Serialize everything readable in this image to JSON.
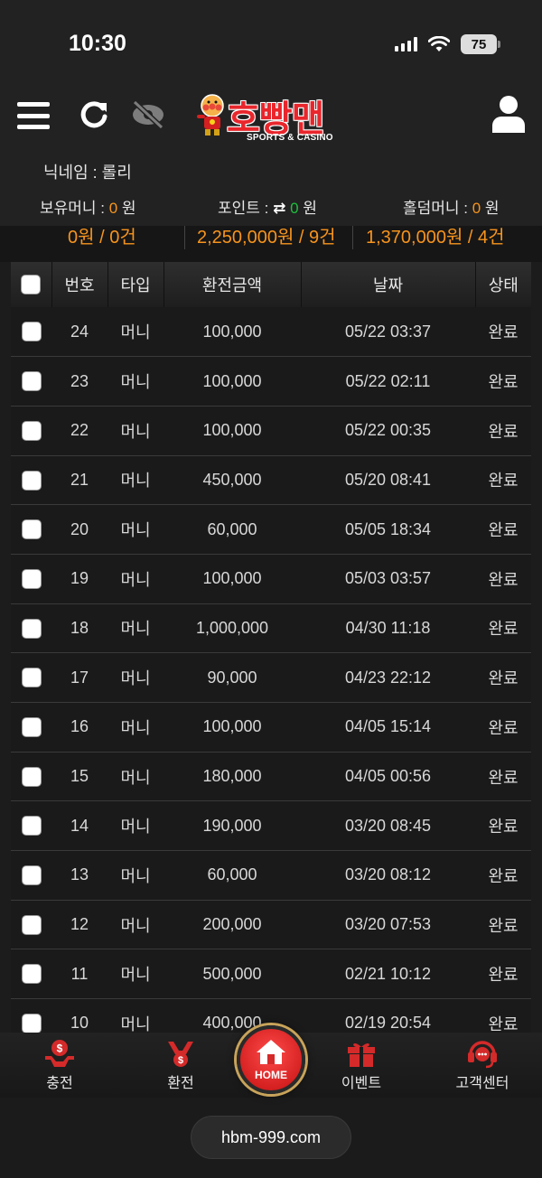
{
  "status": {
    "time": "10:30",
    "battery": "75"
  },
  "brand": {
    "name": "호빵맨",
    "sub": "SPORTS & CASINO"
  },
  "user": {
    "nickname": "닉네임 : 롤리",
    "money_label": "보유머니 : ",
    "money_value": "0",
    "money_unit": " 원",
    "point_label": "포인트 : ",
    "point_value": "0",
    "point_unit": " 원",
    "holdem_label": "홀덤머니 : ",
    "holdem_value": "0",
    "holdem_unit": " 원"
  },
  "summary": [
    "0원 / 0건",
    "2,250,000원 / 9건",
    "1,370,000원 / 4건"
  ],
  "table": {
    "headers": [
      "번호",
      "타입",
      "환전금액",
      "날짜",
      "상태"
    ],
    "rows": [
      {
        "no": "24",
        "type": "머니",
        "amount": "100,000",
        "date": "05/22 03:37",
        "status": "완료"
      },
      {
        "no": "23",
        "type": "머니",
        "amount": "100,000",
        "date": "05/22 02:11",
        "status": "완료"
      },
      {
        "no": "22",
        "type": "머니",
        "amount": "100,000",
        "date": "05/22 00:35",
        "status": "완료"
      },
      {
        "no": "21",
        "type": "머니",
        "amount": "450,000",
        "date": "05/20 08:41",
        "status": "완료"
      },
      {
        "no": "20",
        "type": "머니",
        "amount": "60,000",
        "date": "05/05 18:34",
        "status": "완료"
      },
      {
        "no": "19",
        "type": "머니",
        "amount": "100,000",
        "date": "05/03 03:57",
        "status": "완료"
      },
      {
        "no": "18",
        "type": "머니",
        "amount": "1,000,000",
        "date": "04/30 11:18",
        "status": "완료"
      },
      {
        "no": "17",
        "type": "머니",
        "amount": "90,000",
        "date": "04/23 22:12",
        "status": "완료"
      },
      {
        "no": "16",
        "type": "머니",
        "amount": "100,000",
        "date": "04/05 15:14",
        "status": "완료"
      },
      {
        "no": "15",
        "type": "머니",
        "amount": "180,000",
        "date": "04/05 00:56",
        "status": "완료"
      },
      {
        "no": "14",
        "type": "머니",
        "amount": "190,000",
        "date": "03/20 08:45",
        "status": "완료"
      },
      {
        "no": "13",
        "type": "머니",
        "amount": "60,000",
        "date": "03/20 08:12",
        "status": "완료"
      },
      {
        "no": "12",
        "type": "머니",
        "amount": "200,000",
        "date": "03/20 07:53",
        "status": "완료"
      },
      {
        "no": "11",
        "type": "머니",
        "amount": "500,000",
        "date": "02/21 10:12",
        "status": "완료"
      },
      {
        "no": "10",
        "type": "머니",
        "amount": "400,000",
        "date": "02/19 20:54",
        "status": "완료"
      }
    ]
  },
  "nav": {
    "charge": "충전",
    "exchange": "환전",
    "home": "HOME",
    "event": "이벤트",
    "support": "고객센터"
  },
  "url": "hbm-999.com",
  "colors": {
    "accent": "#f7941d",
    "brand_red": "#e8262c",
    "point_green": "#1fbf3f",
    "background": "#1c1c1c"
  },
  "icons": [
    "menu-icon",
    "refresh-icon",
    "eye-off-icon",
    "user-icon",
    "charge-icon",
    "exchange-icon",
    "home-icon",
    "gift-icon",
    "headset-icon"
  ]
}
